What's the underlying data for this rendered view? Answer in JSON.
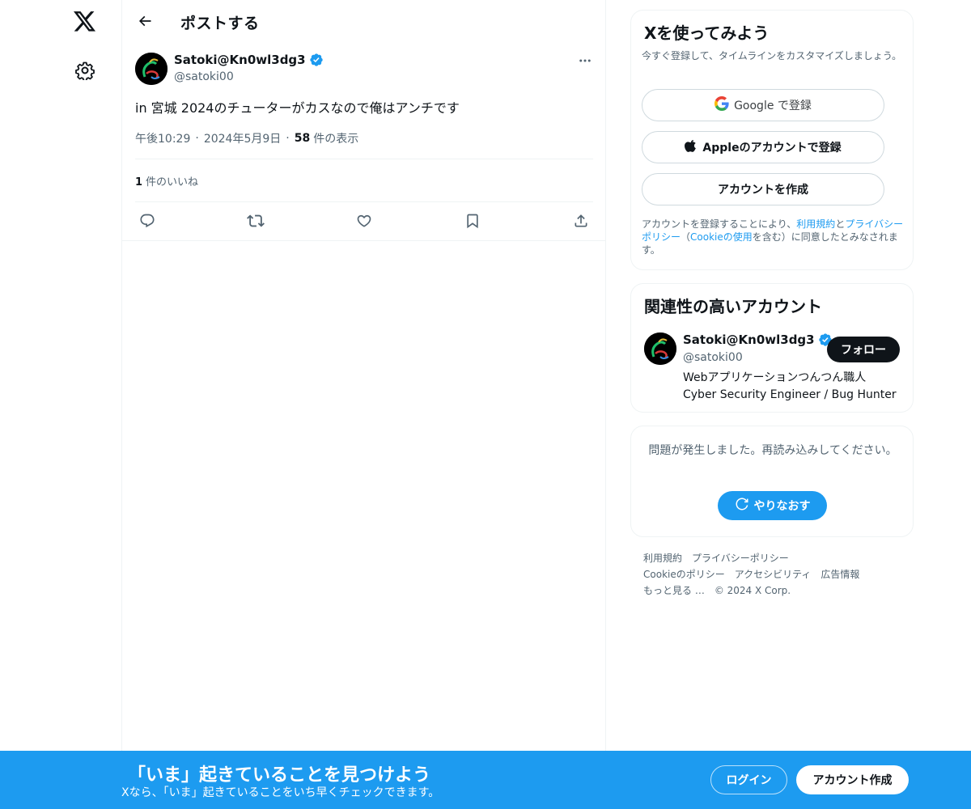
{
  "nav": {
    "logo_icon": "x-logo-icon",
    "settings_icon": "gear-icon"
  },
  "header": {
    "title": "ポストする"
  },
  "post": {
    "author_name": "Satoki@Kn0wl3dg3",
    "author_handle": "@satoki00",
    "text": "in 宮城 2024のチューターがカスなので俺はアンチです",
    "time": "午後10:29",
    "date": "2024年5月9日",
    "views_count": "58",
    "views_label": "件の表示",
    "likes_count": "1",
    "likes_label": "件のいいね"
  },
  "signup_card": {
    "title": "Xを使ってみよう",
    "description": "今すぐ登録して、タイムラインをカスタマイズしましょう。",
    "google_label": "Google で登録",
    "apple_label": "Appleのアカウントで登録",
    "create_label": "アカウントを作成",
    "terms_prefix": "アカウントを登録することにより、",
    "terms_link": "利用規約",
    "terms_and": "と",
    "privacy_link": "プライバシーポリシー",
    "open_paren": "（",
    "cookie_link": "Cookieの使用",
    "terms_suffix": "を含む）に同意したとみなされます。"
  },
  "related": {
    "title": "関連性の高いアカウント",
    "name": "Satoki@Kn0wl3dg3",
    "handle": "@satoki00",
    "follow_label": "フォロー",
    "bio_line1": "Webアプリケーションつんつん職人",
    "bio_line2": "Cyber Security Engineer / Bug Hunter"
  },
  "error_card": {
    "message": "問題が発生しました。再読み込みしてください。",
    "retry_label": "やりなおす"
  },
  "footer": {
    "terms": "利用規約",
    "privacy": "プライバシーポリシー",
    "cookie": "Cookieのポリシー",
    "accessibility": "アクセシビリティ",
    "ads": "広告情報",
    "more": "もっと見る …",
    "copyright": "© 2024 X Corp."
  },
  "bottom_bar": {
    "title": "「いま」起きていることを見つけよう",
    "subtitle": "Xなら、「いま」起きていることをいち早くチェックできます。",
    "login_label": "ログイン",
    "signup_label": "アカウント作成"
  },
  "colors": {
    "accent": "#1d9bf0",
    "text": "#0f1419",
    "muted": "#536471",
    "border": "#eff3f4"
  }
}
